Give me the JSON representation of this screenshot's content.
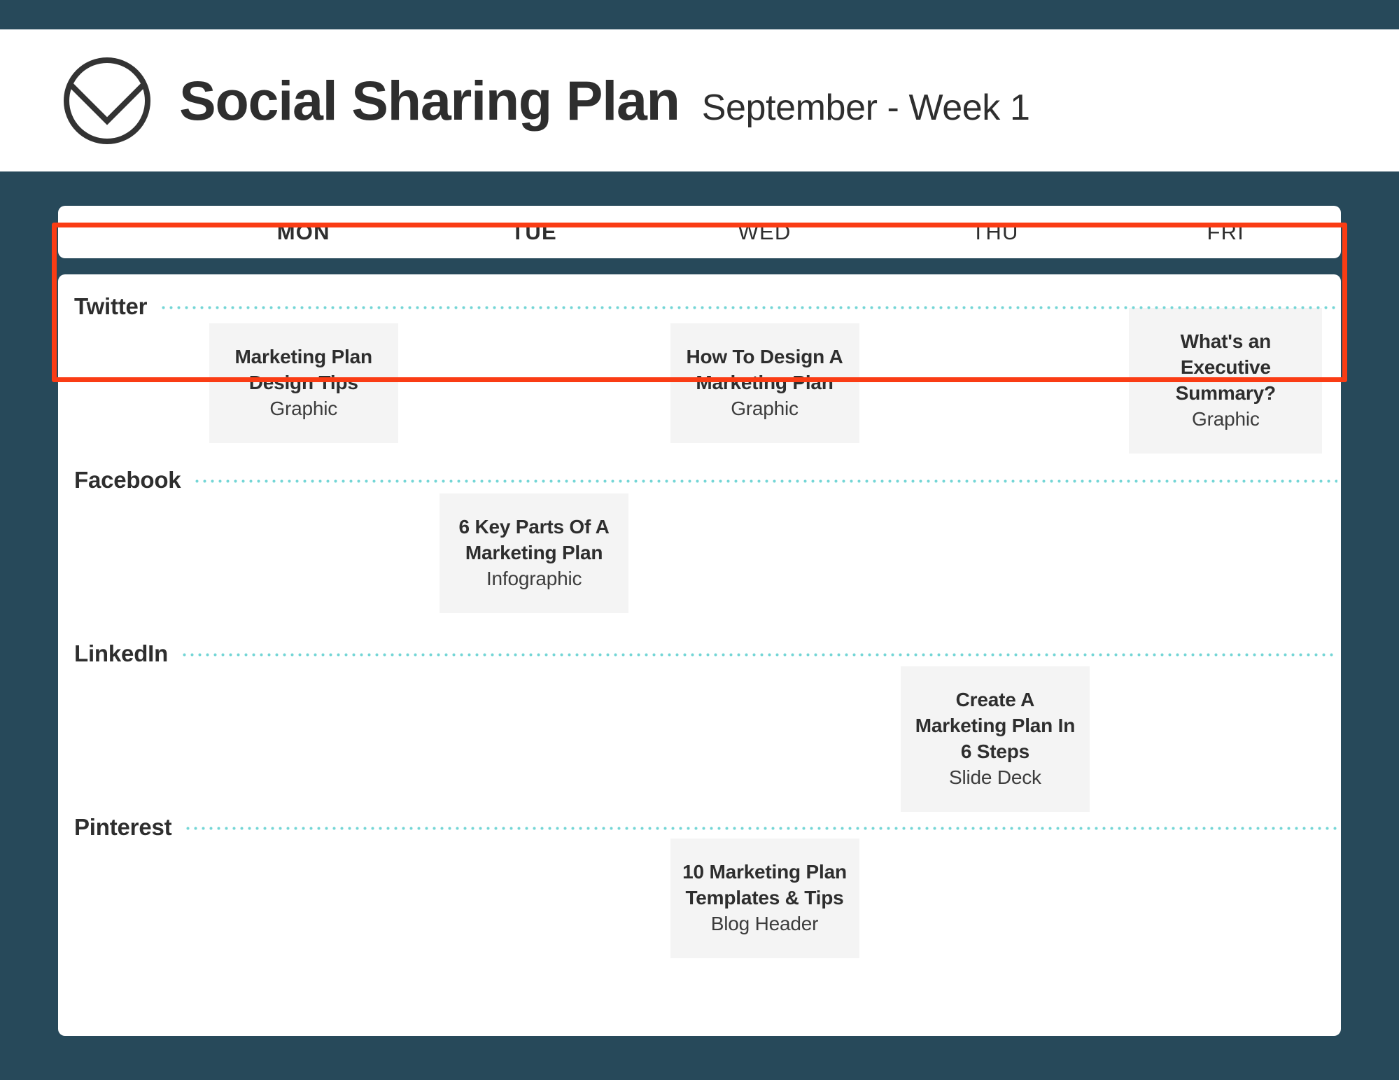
{
  "header": {
    "logo_icon": "circle-chevron-logo",
    "title": "Social Sharing Plan",
    "subtitle": "September - Week 1"
  },
  "theme": {
    "background": "#27495a",
    "panel": "#ffffff",
    "card": "#f4f4f4",
    "dotted_rule": "#74d6d6",
    "highlight": "#fa3c14",
    "text": "#2e2e2e"
  },
  "calendar": {
    "day_headers": [
      {
        "label": "MON",
        "bold": true
      },
      {
        "label": "TUE",
        "bold": true
      },
      {
        "label": "WED",
        "bold": false
      },
      {
        "label": "THU",
        "bold": false
      },
      {
        "label": "FRI",
        "bold": false
      }
    ],
    "rows": [
      {
        "platform": "Twitter",
        "highlighted": true,
        "cards": {
          "MON": {
            "title": "Marketing Plan Design Tips",
            "type": "Graphic"
          },
          "TUE": null,
          "WED": {
            "title": "How To Design A Marketing Plan",
            "type": "Graphic"
          },
          "THU": null,
          "FRI": {
            "title": "What's an Executive Summary?",
            "type": "Graphic"
          }
        }
      },
      {
        "platform": "Facebook",
        "highlighted": false,
        "cards": {
          "MON": null,
          "TUE": {
            "title": "6 Key Parts Of A Marketing Plan",
            "type": "Infographic"
          },
          "WED": null,
          "THU": null,
          "FRI": null
        }
      },
      {
        "platform": "LinkedIn",
        "highlighted": false,
        "cards": {
          "MON": null,
          "TUE": null,
          "WED": null,
          "THU": {
            "title": "Create A Marketing Plan In 6 Steps",
            "type": "Slide Deck"
          },
          "FRI": null
        }
      },
      {
        "platform": "Pinterest",
        "highlighted": false,
        "cards": {
          "MON": null,
          "TUE": null,
          "WED": {
            "title": "10 Marketing Plan Templates & Tips",
            "type": "Blog Header"
          },
          "THU": null,
          "FRI": null
        }
      }
    ]
  }
}
